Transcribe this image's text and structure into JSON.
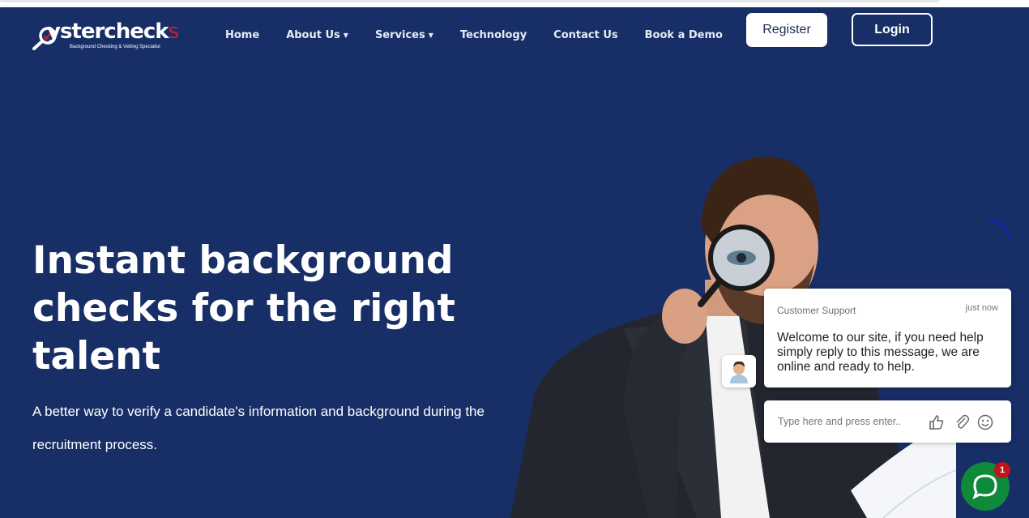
{
  "logo": {
    "word_part1": "ystercheck",
    "word_part2": "s",
    "word_dark": "oyster",
    "word_red": "checks",
    "tagline": "Background Checking & Vetting Specialist"
  },
  "nav": {
    "items": [
      {
        "label": "Home"
      },
      {
        "label": "About Us",
        "dropdown": true
      },
      {
        "label": "Services",
        "dropdown": true
      },
      {
        "label": "Technology"
      },
      {
        "label": "Contact Us"
      },
      {
        "label": "Book a Demo"
      }
    ],
    "register_label": "Register",
    "login_label": "Login"
  },
  "hero": {
    "title": "Instant background checks for the right talent",
    "subtitle": "A better way to verify a candidate's information and background during the recruitment process."
  },
  "chat": {
    "agent": "Customer Support",
    "time": "just now",
    "message": "Welcome to our site, if you need help simply reply to this message, we are online and ready to help.",
    "input_placeholder": "Type here and press enter..",
    "badge_count": "1"
  },
  "colors": {
    "background": "#172e66",
    "brand_red": "#c8202c",
    "chat_green": "#0e8a3a"
  }
}
